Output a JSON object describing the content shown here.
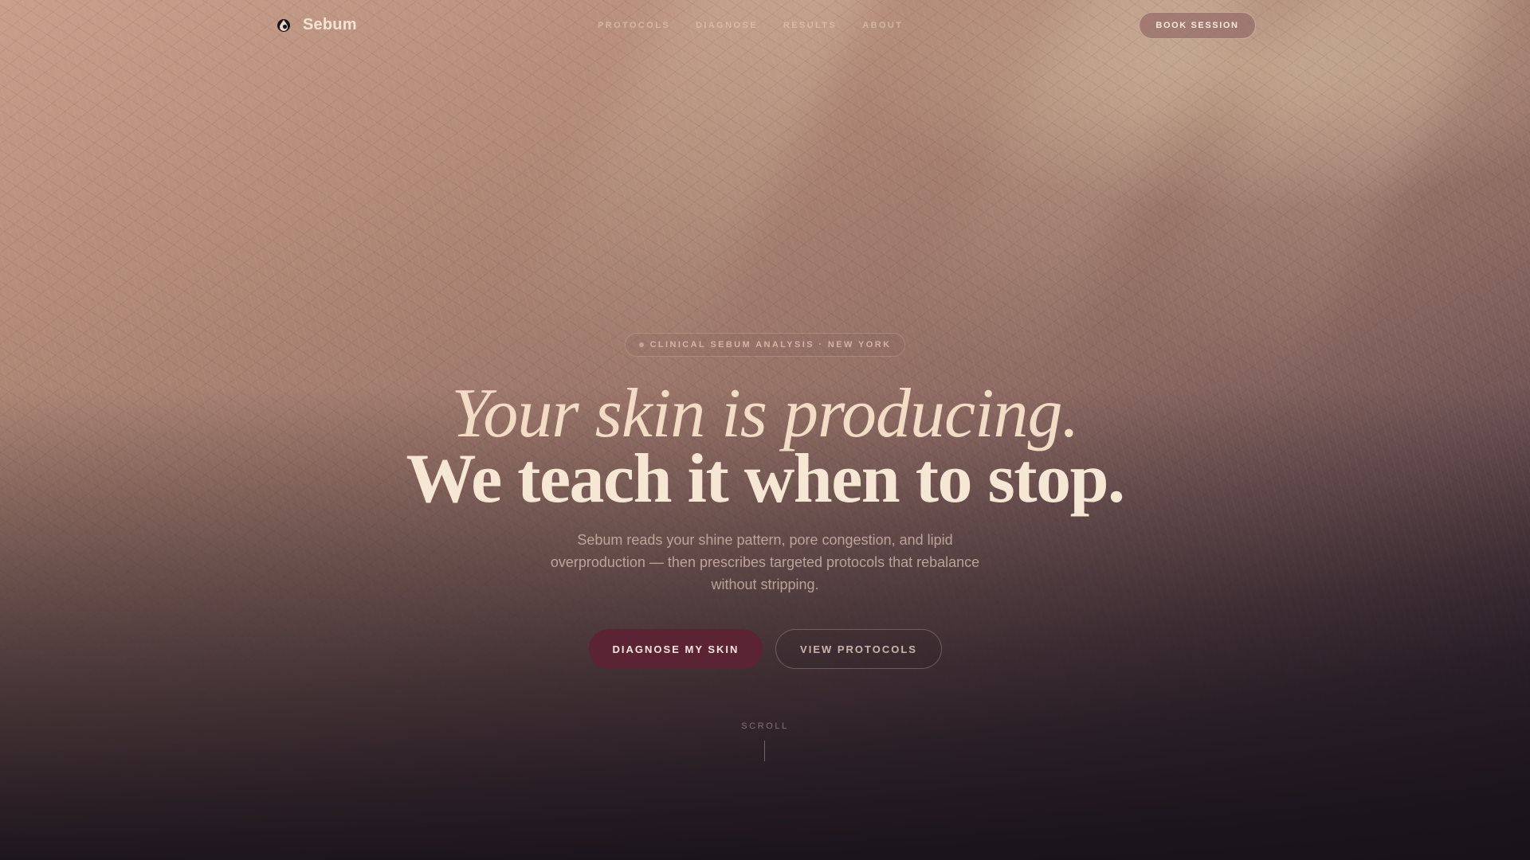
{
  "brand": {
    "name": "Sebum",
    "icon": "droplet-icon"
  },
  "nav": {
    "links": [
      "PROTOCOLS",
      "DIAGNOSE",
      "RESULTS",
      "ABOUT"
    ],
    "book_label": "BOOK SESSION"
  },
  "hero": {
    "badge": "CLINICAL SEBUM ANALYSIS · NEW YORK",
    "headline_line1": "Your skin is producing.",
    "headline_line2": "We teach it when to stop.",
    "subtext": "Sebum reads your shine pattern, pore congestion, and lipid overproduction — then prescribes targeted protocols that rebalance without stripping.",
    "primary_cta": "DIAGNOSE MY SKIN",
    "secondary_cta": "VIEW PROTOCOLS",
    "scroll_label": "SCROLL"
  },
  "colors": {
    "accent": "#5b2434",
    "headline": "#f6e6d4",
    "book_button": "#9a6f69",
    "page_bottom": "#1b1319"
  }
}
